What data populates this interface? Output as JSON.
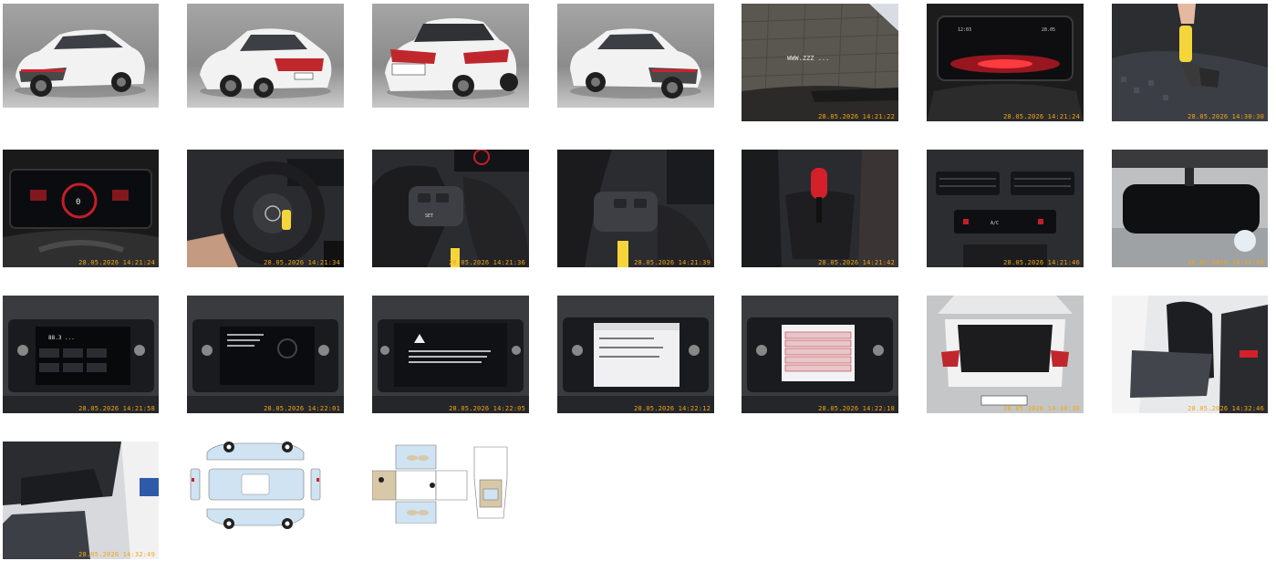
{
  "gallery": {
    "photos": [
      {
        "kind": "studio-front-left",
        "timestamp": ""
      },
      {
        "kind": "studio-rear-left",
        "timestamp": ""
      },
      {
        "kind": "studio-rear",
        "timestamp": ""
      },
      {
        "kind": "studio-front-right",
        "timestamp": ""
      },
      {
        "kind": "windshield",
        "timestamp": "28.05.2026 14:21:22"
      },
      {
        "kind": "cluster-off",
        "timestamp": "28.05.2026 14:21:24"
      },
      {
        "kind": "key",
        "timestamp": "28.05.2026 14:30:30"
      },
      {
        "kind": "cluster-on",
        "timestamp": "28.05.2026 14:21:24"
      },
      {
        "kind": "steering-wheel",
        "timestamp": "28.05.2026 14:21:34"
      },
      {
        "kind": "wheel-left-buttons",
        "timestamp": "28.05.2026 14:21:36"
      },
      {
        "kind": "wheel-right-buttons",
        "timestamp": "28.05.2026 14:21:39"
      },
      {
        "kind": "gear-lever",
        "timestamp": "28.05.2026 14:21:42"
      },
      {
        "kind": "climate-panel",
        "timestamp": "28.05.2026 14:21:46"
      },
      {
        "kind": "rear-mirror",
        "timestamp": "28.05.2026 14:21:49"
      },
      {
        "kind": "infotainment-radio",
        "timestamp": "28.05.2026 14:21:58"
      },
      {
        "kind": "infotainment-menu",
        "timestamp": "28.05.2026 14:22:01"
      },
      {
        "kind": "infotainment-warning",
        "timestamp": "28.05.2026 14:22:05"
      },
      {
        "kind": "infotainment-service",
        "timestamp": "28.05.2026 14:22:12"
      },
      {
        "kind": "infotainment-list",
        "timestamp": "28.05.2026 14:22:18"
      },
      {
        "kind": "trunk",
        "timestamp": "28.05.2026 14:30:30"
      },
      {
        "kind": "rear-seats",
        "timestamp": "28.05.2026 14:32:46"
      },
      {
        "kind": "front-interior",
        "timestamp": "28.05.2026 14:32:49"
      }
    ],
    "diagrams": [
      {
        "kind": "exterior-damage-chart"
      },
      {
        "kind": "interior-damage-chart"
      }
    ]
  },
  "colors": {
    "stamp": "#f2a516",
    "studio_bg": "#8d8d8d",
    "car_white": "#efefef",
    "accent_red": "#d3202a",
    "diagram_blue": "#cfe3f2",
    "diagram_tan": "#d8c8a8"
  }
}
